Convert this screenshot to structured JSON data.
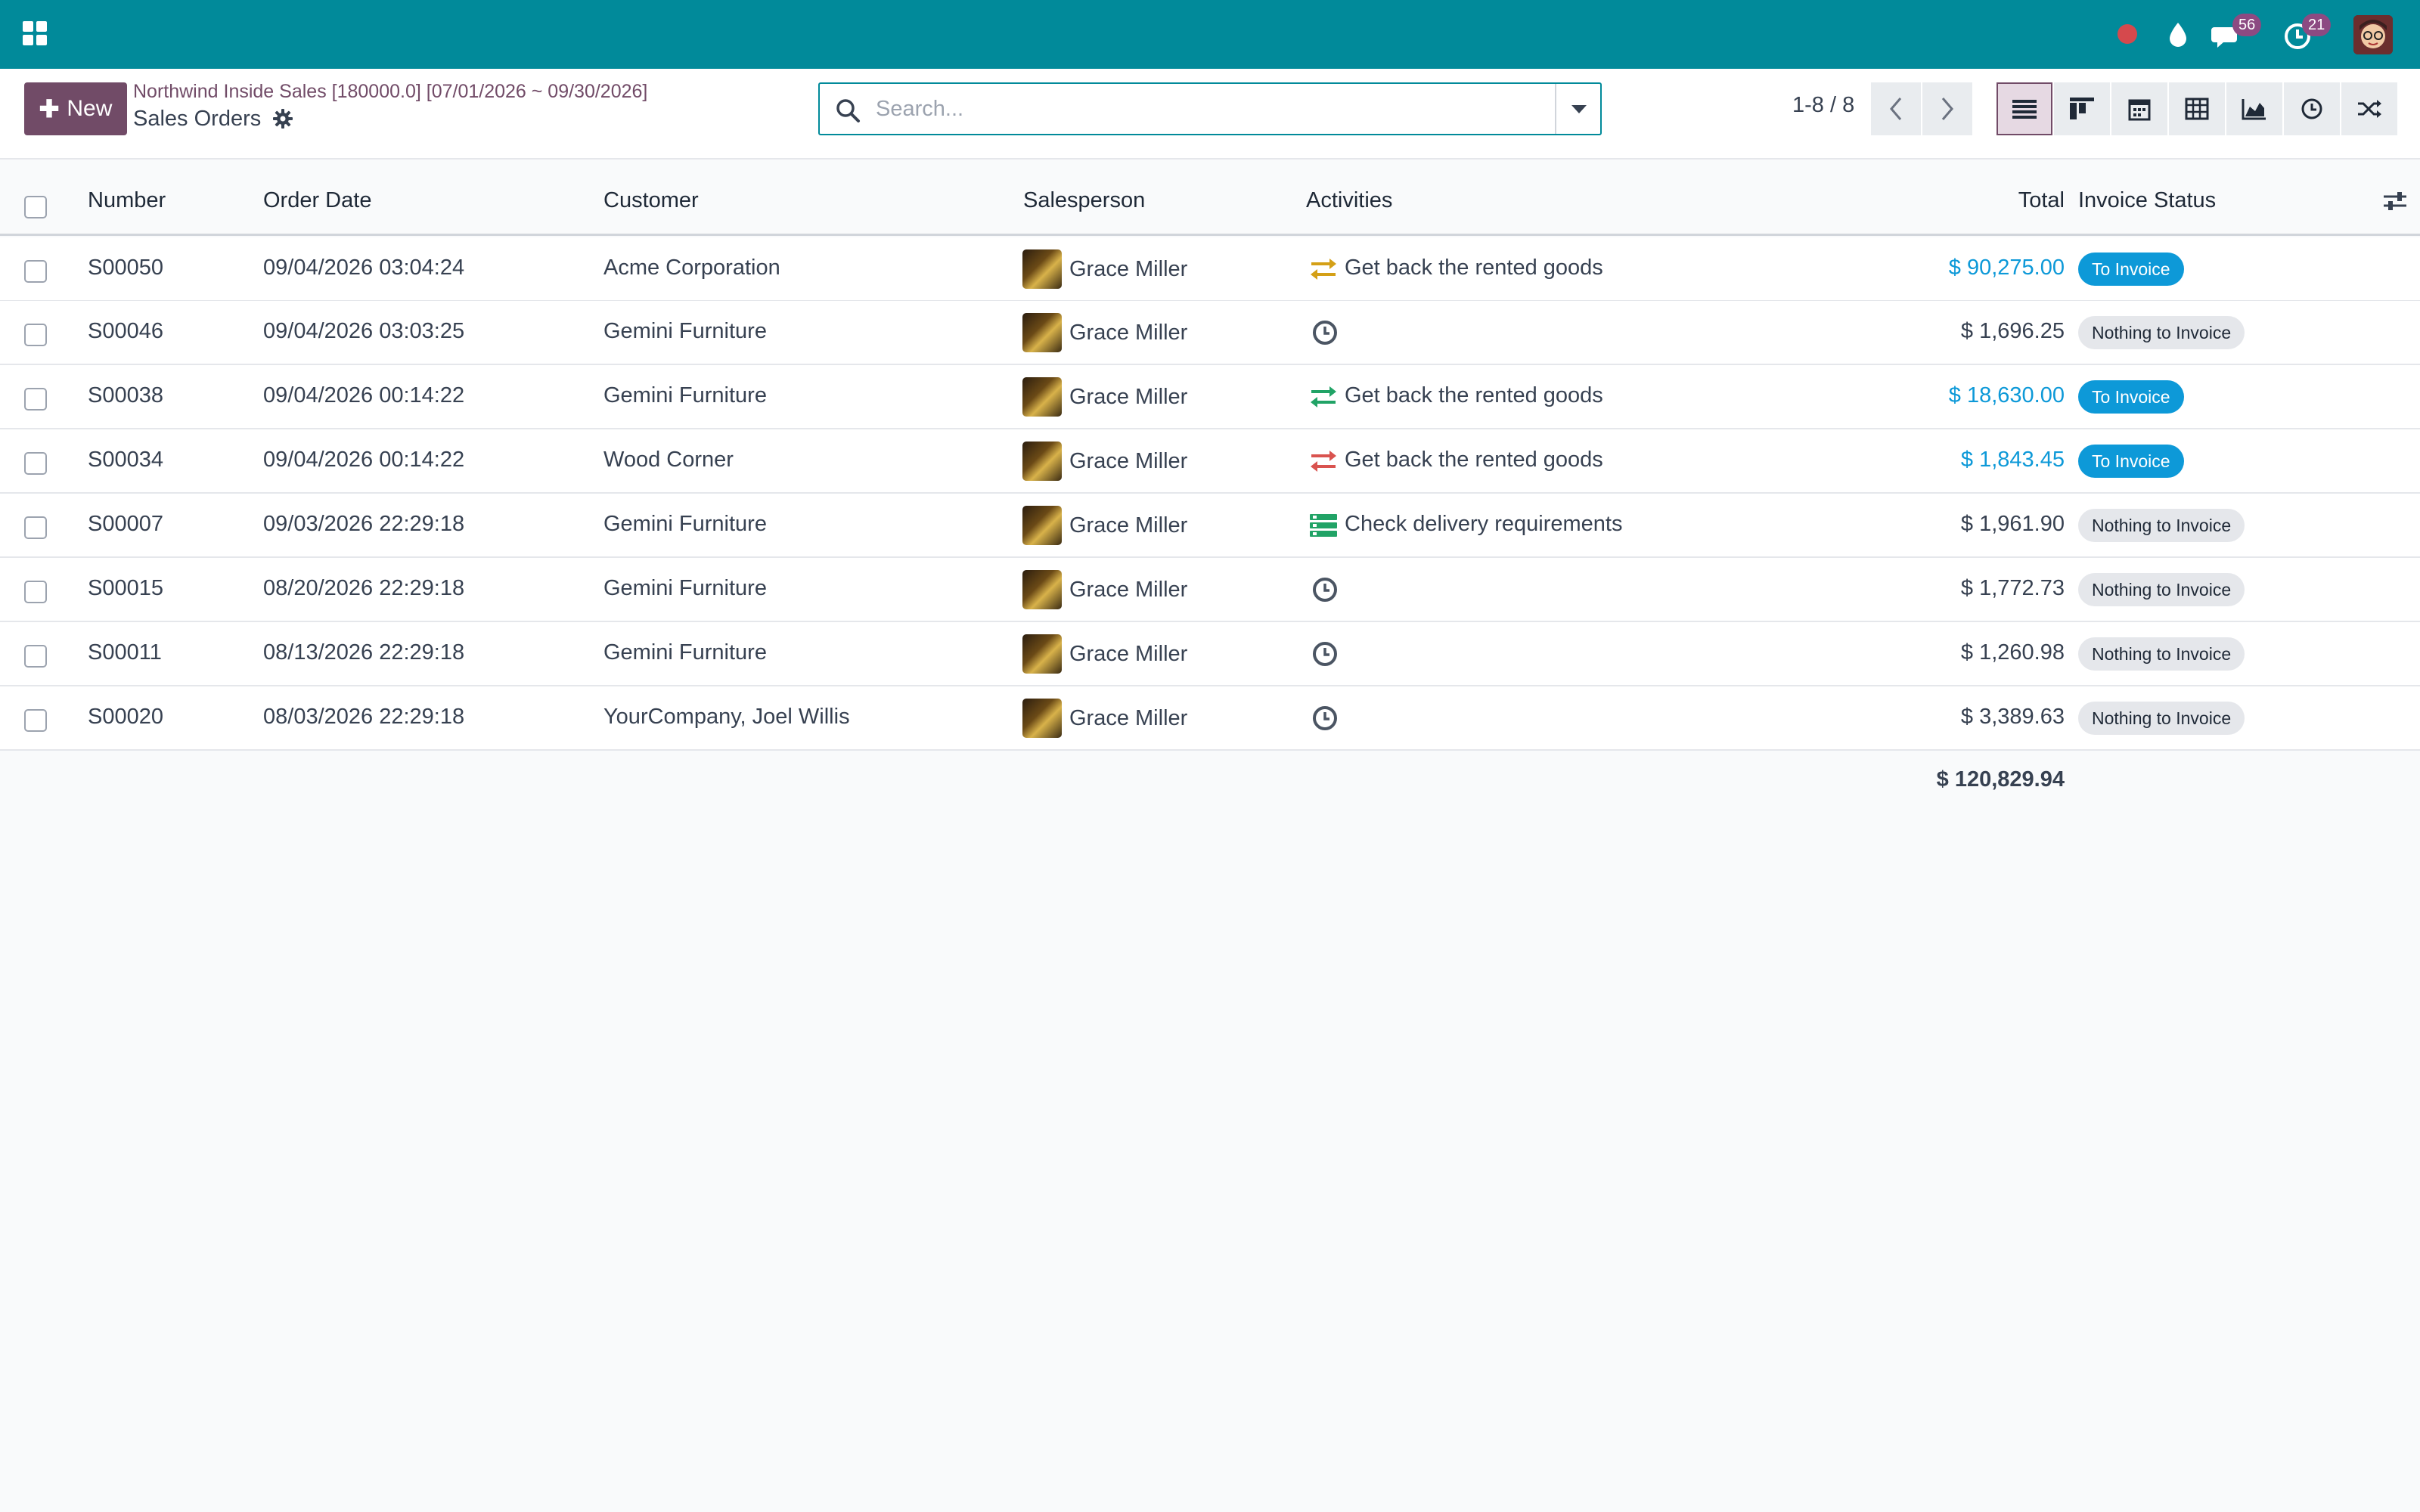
{
  "navbar": {
    "messages_count": "56",
    "activities_count": "21"
  },
  "control": {
    "new_label": "New",
    "breadcrumb": "Northwind Inside Sales [180000.0] [07/01/2026 ~ 09/30/2026]",
    "title": "Sales Orders",
    "search_placeholder": "Search...",
    "pager": "1-8 / 8"
  },
  "table": {
    "headers": {
      "number": "Number",
      "order_date": "Order Date",
      "customer": "Customer",
      "salesperson": "Salesperson",
      "activities": "Activities",
      "total": "Total",
      "invoice_status": "Invoice Status"
    },
    "rows": [
      {
        "number": "S00050",
        "date": "09/04/2026 03:04:24",
        "customer": "Acme Corporation",
        "salesperson": "Grace Miller",
        "activity": "Get back the rented goods",
        "activity_icon": "exchange-icon",
        "activity_color": "#d4a017",
        "total": "$ 90,275.00",
        "status": "To Invoice"
      },
      {
        "number": "S00046",
        "date": "09/04/2026 03:03:25",
        "customer": "Gemini Furniture",
        "salesperson": "Grace Miller",
        "activity": "",
        "activity_icon": "clock-icon",
        "activity_color": "#4b5563",
        "total": "$ 1,696.25",
        "status": "Nothing to Invoice"
      },
      {
        "number": "S00038",
        "date": "09/04/2026 00:14:22",
        "customer": "Gemini Furniture",
        "salesperson": "Grace Miller",
        "activity": "Get back the rented goods",
        "activity_icon": "exchange-icon",
        "activity_color": "#21a366",
        "total": "$ 18,630.00",
        "status": "To Invoice"
      },
      {
        "number": "S00034",
        "date": "09/04/2026 00:14:22",
        "customer": "Wood Corner",
        "salesperson": "Grace Miller",
        "activity": "Get back the rented goods",
        "activity_icon": "exchange-icon",
        "activity_color": "#d9534f",
        "total": "$ 1,843.45",
        "status": "To Invoice"
      },
      {
        "number": "S00007",
        "date": "09/03/2026 22:29:18",
        "customer": "Gemini Furniture",
        "salesperson": "Grace Miller",
        "activity": "Check delivery requirements",
        "activity_icon": "tasks-icon",
        "activity_color": "#21a366",
        "total": "$ 1,961.90",
        "status": "Nothing to Invoice"
      },
      {
        "number": "S00015",
        "date": "08/20/2026 22:29:18",
        "customer": "Gemini Furniture",
        "salesperson": "Grace Miller",
        "activity": "",
        "activity_icon": "clock-icon",
        "activity_color": "#4b5563",
        "total": "$ 1,772.73",
        "status": "Nothing to Invoice"
      },
      {
        "number": "S00011",
        "date": "08/13/2026 22:29:18",
        "customer": "Gemini Furniture",
        "salesperson": "Grace Miller",
        "activity": "",
        "activity_icon": "clock-icon",
        "activity_color": "#4b5563",
        "total": "$ 1,260.98",
        "status": "Nothing to Invoice"
      },
      {
        "number": "S00020",
        "date": "08/03/2026 22:29:18",
        "customer": "YourCompany, Joel Willis",
        "salesperson": "Grace Miller",
        "activity": "",
        "activity_icon": "clock-icon",
        "activity_color": "#4b5563",
        "total": "$ 3,389.63",
        "status": "Nothing to Invoice"
      }
    ],
    "grand_total": "$ 120,829.94"
  },
  "colors": {
    "navbar": "#018a9a",
    "primary": "#714b67",
    "link_blue": "#0d99d8"
  }
}
